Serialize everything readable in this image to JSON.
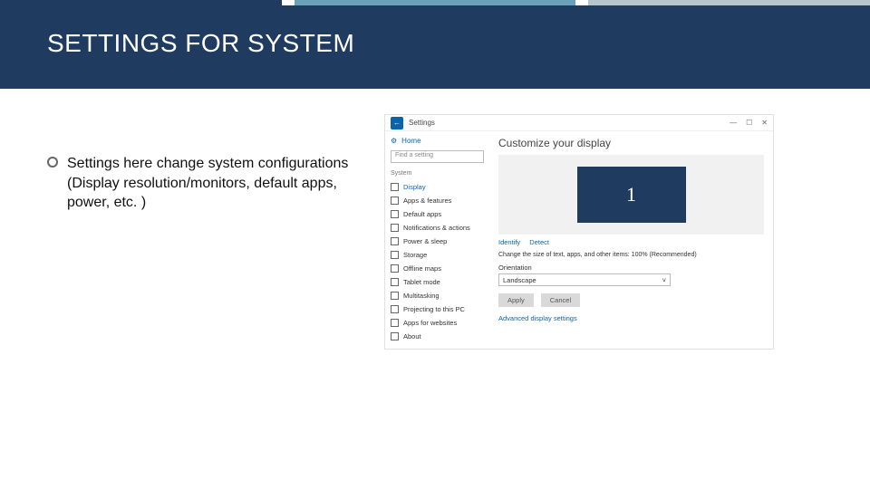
{
  "slide": {
    "title": "SETTINGS FOR SYSTEM",
    "bullet_main": "Settings here change system configurations",
    "bullet_sub": "(Display resolution/monitors, default apps, power, etc. )"
  },
  "settings_window": {
    "back_glyph": "←",
    "window_title": "Settings",
    "win_min": "—",
    "win_max": "☐",
    "win_close": "✕",
    "home_label": "Home",
    "search_placeholder": "Find a setting",
    "category_label": "System",
    "nav": [
      {
        "label": "Display",
        "selected": true
      },
      {
        "label": "Apps & features",
        "selected": false
      },
      {
        "label": "Default apps",
        "selected": false
      },
      {
        "label": "Notifications & actions",
        "selected": false
      },
      {
        "label": "Power & sleep",
        "selected": false
      },
      {
        "label": "Storage",
        "selected": false
      },
      {
        "label": "Offline maps",
        "selected": false
      },
      {
        "label": "Tablet mode",
        "selected": false
      },
      {
        "label": "Multitasking",
        "selected": false
      },
      {
        "label": "Projecting to this PC",
        "selected": false
      },
      {
        "label": "Apps for websites",
        "selected": false
      },
      {
        "label": "About",
        "selected": false
      }
    ],
    "content": {
      "heading": "Customize your display",
      "monitor_number": "1",
      "identify": "Identify",
      "detect": "Detect",
      "resolution_text": "Change the size of text, apps, and other items: 100% (Recommended)",
      "orientation_label": "Orientation",
      "orientation_value": "Landscape",
      "apply": "Apply",
      "cancel": "Cancel",
      "advanced": "Advanced display settings"
    }
  }
}
